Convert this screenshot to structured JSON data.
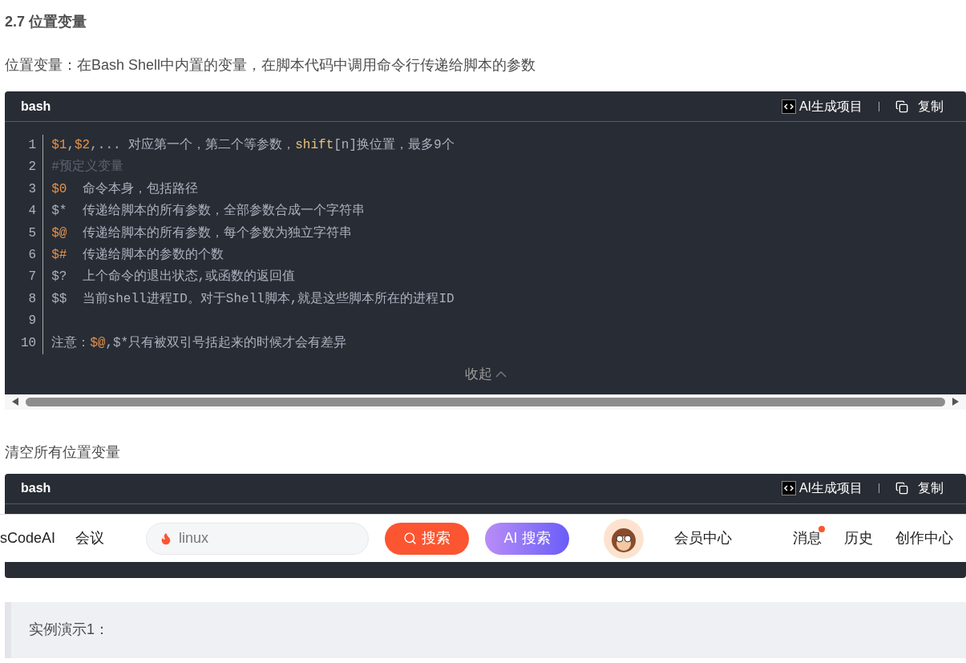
{
  "heading": "2.7 位置变量",
  "intro": "位置变量：在Bash Shell中内置的变量，在脚本代码中调用命令行传递给脚本的参数",
  "code_block_1": {
    "language": "bash",
    "ai_button": "AI生成项目",
    "copy_button": "复制",
    "collapse": "收起",
    "lines": [
      {
        "number": "1",
        "segments": [
          {
            "kind": "var",
            "text": "$1"
          },
          {
            "kind": "text",
            "text": ","
          },
          {
            "kind": "var",
            "text": "$2"
          },
          {
            "kind": "text",
            "text": ",... 对应第一个，第二个等参数，"
          },
          {
            "kind": "keyword",
            "text": "shift"
          },
          {
            "kind": "text",
            "text": "[n]换位置，最多9个"
          }
        ]
      },
      {
        "number": "2",
        "segments": [
          {
            "kind": "comment",
            "text": "#预定义变量"
          }
        ]
      },
      {
        "number": "3",
        "segments": [
          {
            "kind": "var",
            "text": "$0"
          },
          {
            "kind": "text",
            "text": "  命令本身，包括路径"
          }
        ]
      },
      {
        "number": "4",
        "segments": [
          {
            "kind": "text",
            "text": "$*  传递给脚本的所有参数，全部参数合成一个字符串"
          }
        ]
      },
      {
        "number": "5",
        "segments": [
          {
            "kind": "var",
            "text": "$@"
          },
          {
            "kind": "text",
            "text": "  传递给脚本的所有参数，每个参数为独立字符串"
          }
        ]
      },
      {
        "number": "6",
        "segments": [
          {
            "kind": "var",
            "text": "$#"
          },
          {
            "kind": "text",
            "text": "  传递给脚本的参数的个数"
          }
        ]
      },
      {
        "number": "7",
        "segments": [
          {
            "kind": "text",
            "text": "$?  上个命令的退出状态,或函数的返回值"
          }
        ]
      },
      {
        "number": "8",
        "segments": [
          {
            "kind": "text",
            "text": "$$  当前shell进程ID。对于Shell脚本,就是这些脚本所在的进程ID"
          }
        ]
      },
      {
        "number": "9"
      },
      {
        "number": "10",
        "segments": [
          {
            "kind": "text",
            "text": "注意："
          },
          {
            "kind": "var",
            "text": "$@"
          },
          {
            "kind": "text",
            "text": ",$*只有被双引号括起来的时候才会有差异"
          }
        ]
      }
    ]
  },
  "paragraph_2": "清空所有位置变量",
  "code_block_2": {
    "language": "bash",
    "ai_button": "AI生成项目",
    "copy_button": "复制"
  },
  "navbar": {
    "items_left": [
      "sCodeAI",
      "会议"
    ],
    "search_value": "linux",
    "search_button": "搜索",
    "ai_search_button": "AI 搜索",
    "items_right": [
      {
        "label": "会员中心",
        "notification": false
      },
      {
        "label": "消息",
        "notification": true
      },
      {
        "label": "历史",
        "notification": false
      },
      {
        "label": "创作中心",
        "notification": false
      }
    ]
  },
  "quote": "实例演示1："
}
